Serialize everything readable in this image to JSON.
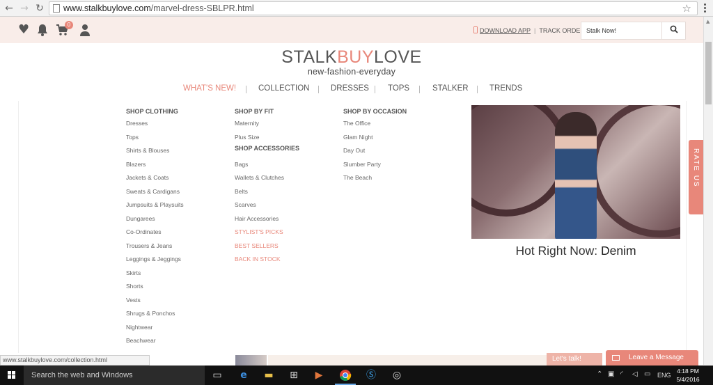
{
  "browser": {
    "back": "←",
    "forward": "→",
    "reload": "↻",
    "url_host": "www.stalkbuylove.com",
    "url_path": "/marvel-dress-SBLPR.html",
    "star": "☆"
  },
  "topbar": {
    "cart_count": "0",
    "download_app": "DOWNLOAD APP",
    "separator": "|",
    "track_order": "TRACK ORDER",
    "search_placeholder": "Stalk Now!",
    "search_icon": "⚲"
  },
  "logo": {
    "part1": "STALK",
    "part2": "BUY",
    "part3": "LOVE",
    "tagline": "new-fashion-everyday"
  },
  "nav": [
    {
      "label": "WHAT'S NEW!",
      "active": true
    },
    {
      "label": "COLLECTION"
    },
    {
      "label": "DRESSES"
    },
    {
      "label": "TOPS"
    },
    {
      "label": "STALKER"
    },
    {
      "label": "TRENDS"
    }
  ],
  "menu": {
    "col1": {
      "heading": "SHOP CLOTHING",
      "links": [
        "Dresses",
        "Tops",
        "Shirts & Blouses",
        "Blazers",
        "Jackets & Coats",
        "Sweats & Cardigans",
        "Jumpsuits & Playsuits",
        "Dungarees",
        "Co-Ordinates",
        "Trousers & Jeans",
        "Leggings & Jeggings",
        "Skirts",
        "Shorts",
        "Vests",
        "Shrugs & Ponchos",
        "Nightwear",
        "Beachwear"
      ]
    },
    "col2": {
      "heading": "SHOP BY FIT",
      "links": [
        "Maternity",
        "Plus Size"
      ],
      "heading2": "SHOP ACCESSORIES",
      "links2": [
        "Bags",
        "Wallets & Clutches",
        "Belts",
        "Scarves",
        "Hair Accessories"
      ],
      "pink_links": [
        "STYLIST'S PICKS",
        "BEST SELLERS",
        "BACK IN STOCK"
      ]
    },
    "col3": {
      "heading": "SHOP BY OCCASION",
      "links": [
        "The Office",
        "Glam Night",
        "Day Out",
        "Slumber Party",
        "The Beach"
      ]
    }
  },
  "promo": {
    "caption_prefix": "Hot Right Now: ",
    "caption_bold": "Denim"
  },
  "rate_us": "RATE US",
  "status_url": "www.stalkbuylove.com/collection.html",
  "chat": {
    "lets_talk": "Let's talk!",
    "leave_message": "Leave a Message"
  },
  "taskbar": {
    "search_text": "Search the web and Windows",
    "lang": "ENG",
    "time": "4:18 PM",
    "date": "5/4/2016"
  },
  "colors": {
    "accent": "#e8877a",
    "topbar_bg": "#f9ede9"
  }
}
